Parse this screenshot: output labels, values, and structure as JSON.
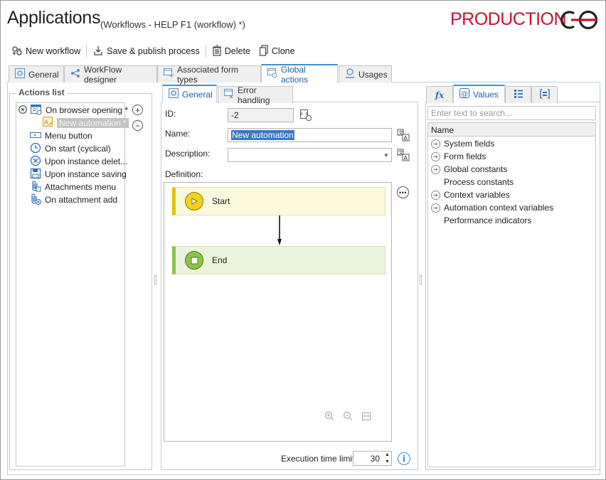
{
  "header": {
    "title": "Applications",
    "subtitle": "(Workflows - HELP F1 (workflow) *)",
    "environment": "PRODUCTION",
    "brand_color": "#c8102e"
  },
  "toolbar": {
    "new_workflow": "New workflow",
    "save_publish": "Save & publish process",
    "delete": "Delete",
    "clone": "Clone"
  },
  "tabs": {
    "general": "General",
    "workflow_designer": "WorkFlow designer",
    "associated_form_types": "Associated form types",
    "global_actions": "Global actions",
    "usages": "Usages",
    "active": "Global actions"
  },
  "actions_list": {
    "title": "Actions list",
    "items": [
      {
        "label": "On browser opening *",
        "icon": "browser-icon"
      },
      {
        "label": "New automation *",
        "icon": "automation-icon",
        "selected": true
      },
      {
        "label": "Menu button",
        "icon": "menu-button-icon"
      },
      {
        "label": "On start (cyclical)",
        "icon": "clock-icon"
      },
      {
        "label": "Upon instance delet...",
        "icon": "delete-circle-icon"
      },
      {
        "label": "Upon instance saving",
        "icon": "save-icon"
      },
      {
        "label": "Attachments menu",
        "icon": "attachment-icon"
      },
      {
        "label": "On attachment add",
        "icon": "attachment-add-icon"
      }
    ]
  },
  "editor": {
    "tabs": {
      "general": "General",
      "error_handling": "Error handling"
    },
    "id_label": "ID:",
    "id_value": "-2",
    "name_label": "Name:",
    "name_value": "New automation",
    "description_label": "Description:",
    "description_value": "",
    "definition_label": "Definition:",
    "start_block": "Start",
    "end_block": "End",
    "start_color": "#e6c400",
    "end_color": "#8cc34a",
    "exec_limit_label": "Execution time limit:",
    "exec_limit_value": "30"
  },
  "right_panel": {
    "tabs": {
      "values": "Values"
    },
    "search_placeholder": "Enter text to search...",
    "column_header": "Name",
    "items": [
      {
        "label": "System fields",
        "expandable": true
      },
      {
        "label": "Form fields",
        "expandable": true
      },
      {
        "label": "Global constants",
        "expandable": true
      },
      {
        "label": "Process constants",
        "expandable": false
      },
      {
        "label": "Context variables",
        "expandable": true
      },
      {
        "label": "Automation context variables",
        "expandable": true
      },
      {
        "label": "Performance indicators",
        "expandable": false
      }
    ]
  }
}
